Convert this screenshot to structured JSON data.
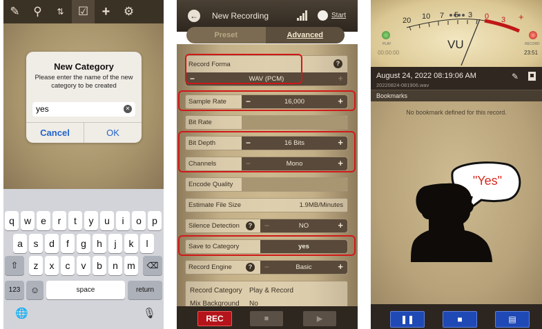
{
  "panel1": {
    "toolbar": {
      "icons": [
        "compose-icon",
        "search-icon",
        "sort-icon",
        "checklist-icon",
        "plus-icon",
        "gear-icon"
      ]
    },
    "dialog": {
      "title": "New Category",
      "message": "Please enter the name of the new category to be created",
      "input_value": "yes",
      "cancel_label": "Cancel",
      "ok_label": "OK"
    },
    "keyboard": {
      "row1": [
        "q",
        "w",
        "e",
        "r",
        "t",
        "y",
        "u",
        "i",
        "o",
        "p"
      ],
      "row2": [
        "a",
        "s",
        "d",
        "f",
        "g",
        "h",
        "j",
        "k",
        "l"
      ],
      "row3": [
        "z",
        "x",
        "c",
        "v",
        "b",
        "n",
        "m"
      ],
      "numbers_label": "123",
      "space_label": "space",
      "return_label": "return"
    }
  },
  "panel2": {
    "title": "New Recording",
    "start_label": "Start",
    "tabs": [
      {
        "label": "Preset",
        "active": false
      },
      {
        "label": "Advanced",
        "active": true
      }
    ],
    "record_format": {
      "label": "Record Forma",
      "value": "WAV (PCM)"
    },
    "sample_rate": {
      "label": "Sample Rate",
      "value": "16,000"
    },
    "bit_rate": {
      "label": "Bit Rate"
    },
    "bit_depth": {
      "label": "Bit Depth",
      "value": "16 Bits"
    },
    "channels": {
      "label": "Channels",
      "value": "Mono"
    },
    "encode_quality": {
      "label": "Encode Quality"
    },
    "estimate_file_size": {
      "label": "Estimate File Size",
      "value": "1.9MB/Minutes"
    },
    "silence_detection": {
      "label": "Silence Detection",
      "value": "NO"
    },
    "save_to_category": {
      "label": "Save to Category",
      "value": "yes"
    },
    "record_engine": {
      "label": "Record Engine",
      "value": "Basic"
    },
    "record_category": {
      "label": "Record Category",
      "value": "Play & Record"
    },
    "mix_background": {
      "label": "Mix Background",
      "value": "No"
    },
    "footer": {
      "rec_label": "REC"
    },
    "highlight_color": "#d01818"
  },
  "panel3": {
    "vu": {
      "scale": [
        "20",
        "10",
        "7",
        "5",
        "3",
        "0",
        "3",
        "+"
      ],
      "label": "VU",
      "play_label": "PLAY",
      "record_label": "RECORD",
      "play_time": "00:00:00",
      "record_time": "23:51"
    },
    "date": "August 24, 2022 08:19:06 AM",
    "filename": "20220824-081906.wav",
    "bookmarks_title": "Bookmarks",
    "empty_message": "No bookmark defined for this record.",
    "speech": "\"Yes\"",
    "speech_color": "#d62a1e",
    "footer_icons": [
      "pause-icon",
      "stop-icon",
      "notes-icon"
    ]
  }
}
